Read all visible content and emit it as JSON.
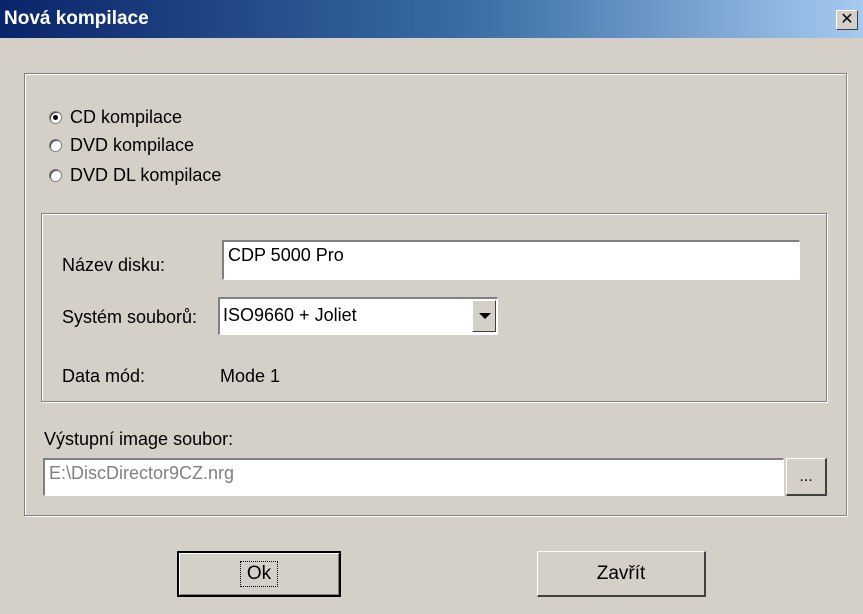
{
  "window": {
    "title": "Nová kompilace",
    "close_label": "✕"
  },
  "compilation_types": [
    {
      "label": "CD kompilace",
      "checked": true
    },
    {
      "label": "DVD kompilace",
      "checked": false
    },
    {
      "label": "DVD DL kompilace",
      "checked": false
    }
  ],
  "form": {
    "disc_name_label": "Název disku:",
    "disc_name_value": "CDP 5000 Pro",
    "filesystem_label": "Systém souborů:",
    "filesystem_value": "ISO9660 + Joliet",
    "data_mode_label": "Data mód:",
    "data_mode_value": "Mode 1"
  },
  "output": {
    "label": "Výstupní image soubor:",
    "path": "E:\\DiscDirector9CZ.nrg",
    "browse_label": "..."
  },
  "buttons": {
    "ok_label": "Ok",
    "close_label": "Zavřít"
  }
}
